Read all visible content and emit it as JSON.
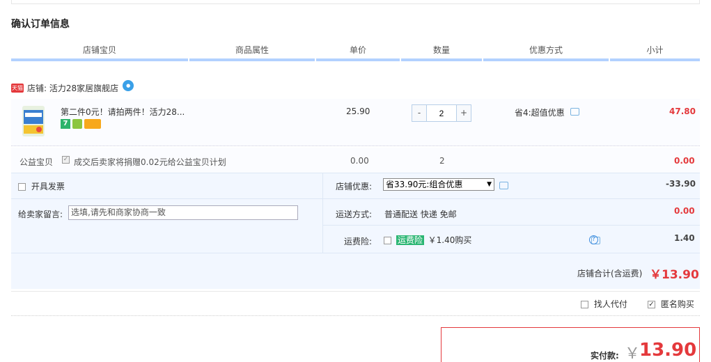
{
  "page": {
    "title": "确认订单信息"
  },
  "table_headers": [
    "店铺宝贝",
    "商品属性",
    "单价",
    "数量",
    "优惠方式",
    "小计"
  ],
  "shop": {
    "badge": "天猫",
    "label": "店铺: 活力28家居旗舰店",
    "wangwang_icon": "wangwang-chat-icon"
  },
  "item": {
    "name": "第二件0元！请拍两件！活力28...",
    "unit_price": "25.90",
    "quantity": "2",
    "qty_minus": "-",
    "qty_plus": "+",
    "discount": "省4:超值优惠",
    "subtotal": "47.80"
  },
  "charity": {
    "label": "公益宝贝",
    "text": "成交后卖家将捐赠0.02元给公益宝贝计划",
    "price": "0.00",
    "qty": "2",
    "subtotal": "0.00"
  },
  "invoice": {
    "label": "开具发票"
  },
  "message": {
    "label": "给卖家留言:",
    "placeholder": "选填,请先和商家协商一致"
  },
  "shop_discount": {
    "label": "店铺优惠:",
    "selected": "省33.90元:组合优惠",
    "amount": "-33.90"
  },
  "shipping": {
    "label": "运送方式:",
    "value": "普通配送 快递 免邮",
    "amount": "0.00"
  },
  "insurance": {
    "label": "运费险:",
    "badge": "运费险",
    "price_text": "￥1.40购买",
    "amount": "1.40"
  },
  "shop_total": {
    "label": "店铺合计(含运费)",
    "value": "￥13.90"
  },
  "options": {
    "proxy_pay": "找人代付",
    "anonymous": "匿名购买"
  },
  "payment": {
    "label": "实付款:",
    "currency": "￥",
    "value": "13.90"
  },
  "colors": {
    "price_red": "#e4393c",
    "header_bar": "#b2d1ff",
    "option_bg": "#f2f7ff"
  }
}
